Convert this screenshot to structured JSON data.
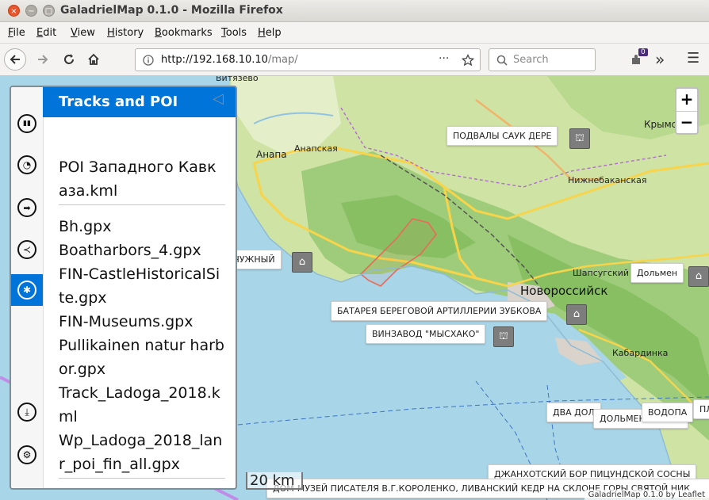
{
  "window": {
    "title": "GaladrielMap 0.1.0 - Mozilla Firefox",
    "close": "×",
    "minimize": "−",
    "maximize": "□"
  },
  "menubar": [
    "File",
    "Edit",
    "View",
    "History",
    "Bookmarks",
    "Tools",
    "Help"
  ],
  "navbar": {
    "url_host": "http://192.168.10.10",
    "url_path": "/map/",
    "url_dots": "···",
    "search_placeholder": "Search",
    "extension_badge": "0",
    "overflow": "»",
    "menu": "☰"
  },
  "sidebar": {
    "title": "Tracks and POI",
    "collapse": "◁",
    "tabs": [
      {
        "name": "map-layers-icon",
        "glyph": "▮▮"
      },
      {
        "name": "speed-gauge-icon",
        "glyph": "◔"
      },
      {
        "name": "route-arrow-icon",
        "glyph": "➡"
      },
      {
        "name": "share-nodes-icon",
        "glyph": "≺"
      },
      {
        "name": "poi-asterisk-icon",
        "glyph": "✱",
        "active": true
      },
      {
        "name": "download-icon",
        "glyph": "⤓"
      },
      {
        "name": "settings-gears-icon",
        "glyph": "⚙"
      }
    ],
    "groups": [
      [
        "POI Западного Кавказа.kml"
      ],
      [
        "Bh.gpx",
        "Boatharbors_4.gpx",
        "FIN-CastleHistoricalSite.gpx",
        "FIN-Museums.gpx",
        "Pullikainen natur harbor.gpx",
        "Track_Ladoga_2018.kml",
        "Wp_Ladoga_2018_lanr_poi_fin_all.gpx"
      ]
    ]
  },
  "map": {
    "zoom_in": "+",
    "zoom_out": "−",
    "scale": "20 km",
    "attribution": "GaladrielMap 0.1.0 by Leaflet",
    "places": {
      "vityazevo": "Витязево",
      "anapa": "Анапа",
      "anapskaya": "Анапская",
      "krymsk": "Крымск",
      "nizhnebakanskaya": "Нижнебаканская",
      "shapsugsky": "Шапсугский д",
      "novorossiysk": "Новороссийск",
      "kabardinka": "Кабардинка"
    },
    "pois": {
      "podvaly": "ПОДВАЛЫ САУК ДЕРЕ",
      "zhemchuzhny": "ЖЕМЧУЖНЫЙ",
      "dolmen": "Дольмен",
      "batareya": "БАТАРЕЯ БЕРЕГОВОЙ АРТИЛЛЕРИИ ЗУБКОВА",
      "vinzavod": "ВИНЗАВОД \"МЫСХАКО\"",
      "dva_dolmena": "ДВА ДОЛ",
      "dolmeny_raya": "ДОЛЬМЕНЫ В РАЙ",
      "vodopad": "ВОДОПА",
      "pli": "ПЛИ",
      "dzhanhot": "ДЖАНХОТСКИЙ БОР ПИЦУНДСКОЙ СОСНЫ",
      "korolenko": "ДОМ-МУЗЕЙ ПИСАТЕЛЯ В.Г.КОРОЛЕНКО, ЛИВАНСКИЙ КЕДР НА СКЛОНЕ ГОРЫ СВЯТОЙ НИК"
    }
  }
}
